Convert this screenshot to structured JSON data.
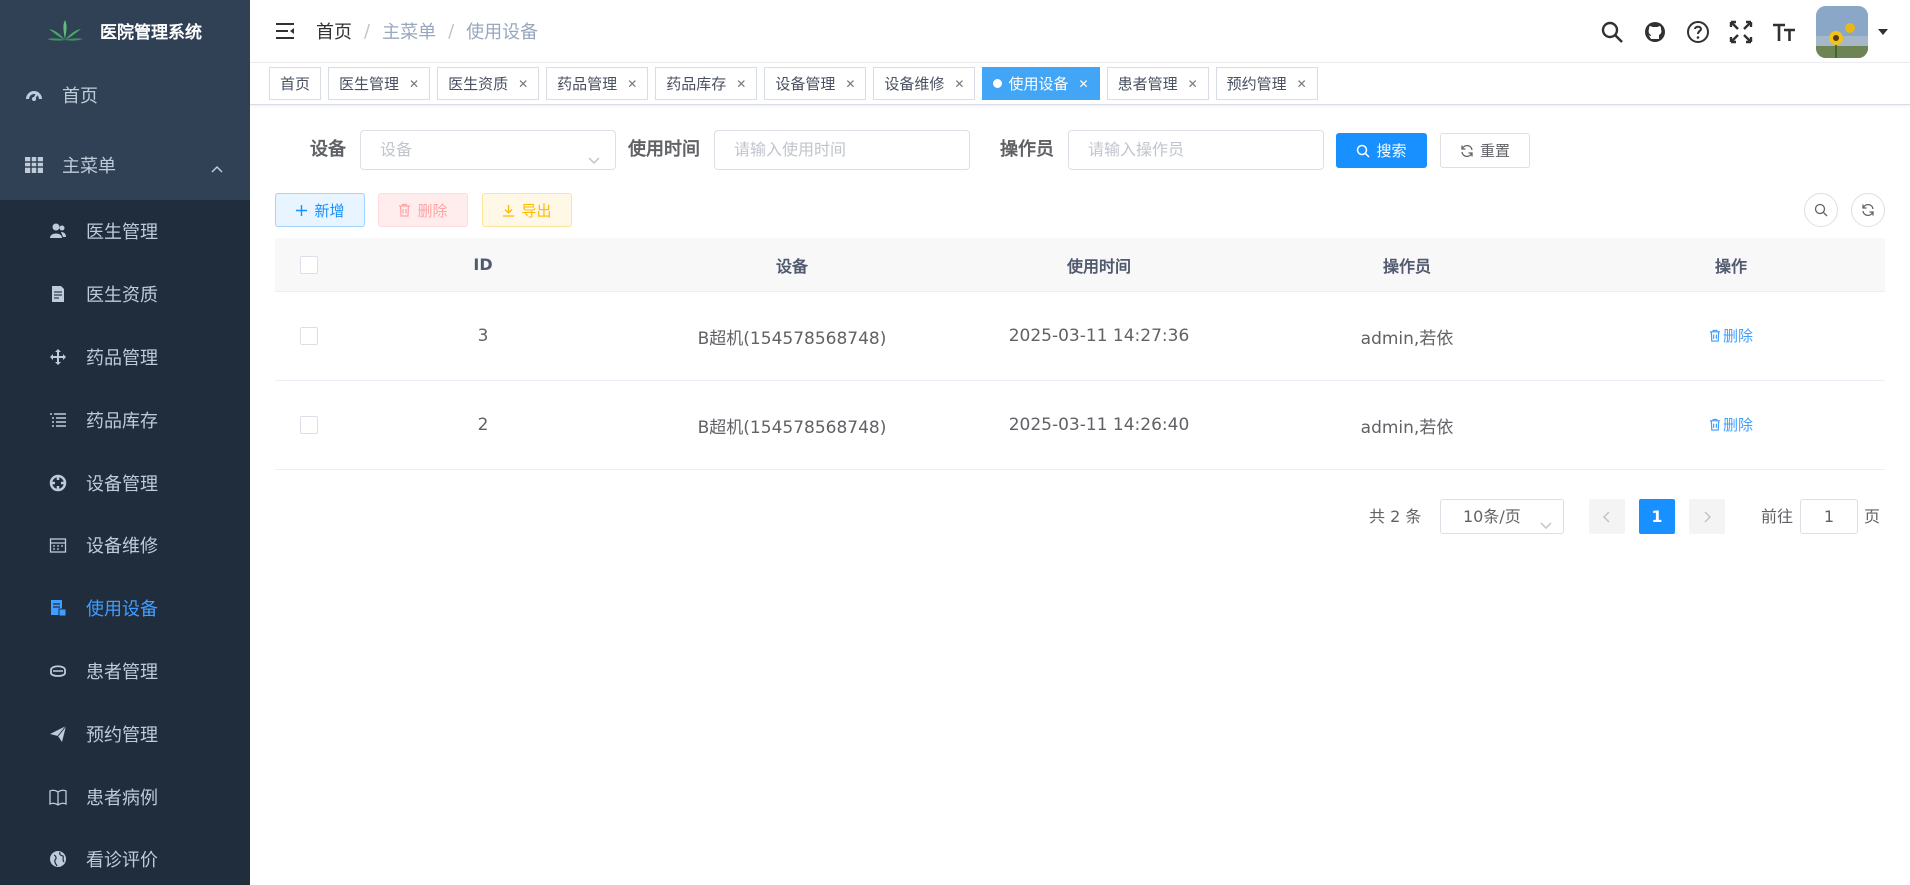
{
  "app": {
    "title": "医院管理系统"
  },
  "sidebar": {
    "home": "首页",
    "main_menu": "主菜单",
    "items": [
      {
        "label": "医生管理",
        "icon": "peoples-icon"
      },
      {
        "label": "医生资质",
        "icon": "documentation-icon"
      },
      {
        "label": "药品管理",
        "icon": "drag-icon"
      },
      {
        "label": "药品库存",
        "icon": "list-icon"
      },
      {
        "label": "设备管理",
        "icon": "component-icon"
      },
      {
        "label": "设备维修",
        "icon": "date-range-icon"
      },
      {
        "label": "使用设备",
        "icon": "form-icon",
        "active": true
      },
      {
        "label": "患者管理",
        "icon": "user-mask-icon"
      },
      {
        "label": "预约管理",
        "icon": "send-icon"
      },
      {
        "label": "患者病例",
        "icon": "book-icon"
      },
      {
        "label": "看诊评价",
        "icon": "globe-icon"
      }
    ]
  },
  "breadcrumb": [
    "首页",
    "主菜单",
    "使用设备"
  ],
  "tags": [
    {
      "label": "首页",
      "closable": false
    },
    {
      "label": "医生管理",
      "closable": true
    },
    {
      "label": "医生资质",
      "closable": true
    },
    {
      "label": "药品管理",
      "closable": true
    },
    {
      "label": "药品库存",
      "closable": true
    },
    {
      "label": "设备管理",
      "closable": true
    },
    {
      "label": "设备维修",
      "closable": true
    },
    {
      "label": "使用设备",
      "closable": true,
      "active": true
    },
    {
      "label": "患者管理",
      "closable": true
    },
    {
      "label": "预约管理",
      "closable": true
    }
  ],
  "search": {
    "device_label": "设备",
    "device_placeholder": "设备",
    "time_label": "使用时间",
    "time_placeholder": "请输入使用时间",
    "operator_label": "操作员",
    "operator_placeholder": "请输入操作员",
    "search_btn": "搜索",
    "reset_btn": "重置"
  },
  "toolbar": {
    "add": "新增",
    "delete": "删除",
    "export": "导出"
  },
  "table": {
    "headers": [
      "ID",
      "设备",
      "使用时间",
      "操作员",
      "操作"
    ],
    "rows": [
      {
        "id": "3",
        "device": "B超机(154578568748)",
        "time": "2025-03-11 14:27:36",
        "operator": "admin,若依",
        "action": "删除"
      },
      {
        "id": "2",
        "device": "B超机(154578568748)",
        "time": "2025-03-11 14:26:40",
        "operator": "admin,若依",
        "action": "删除"
      }
    ]
  },
  "pagination": {
    "total": "共 2 条",
    "page_size": "10条/页",
    "current": "1",
    "goto": "前往",
    "goto_value": "1",
    "page_suffix": "页"
  },
  "colors": {
    "sidebar_bg": "#304156",
    "submenu_bg": "#1f2d3d",
    "primary": "#1890ff",
    "active_tag": "#42a5f5",
    "danger": "#f56c6c",
    "warning": "#e6a23c"
  }
}
